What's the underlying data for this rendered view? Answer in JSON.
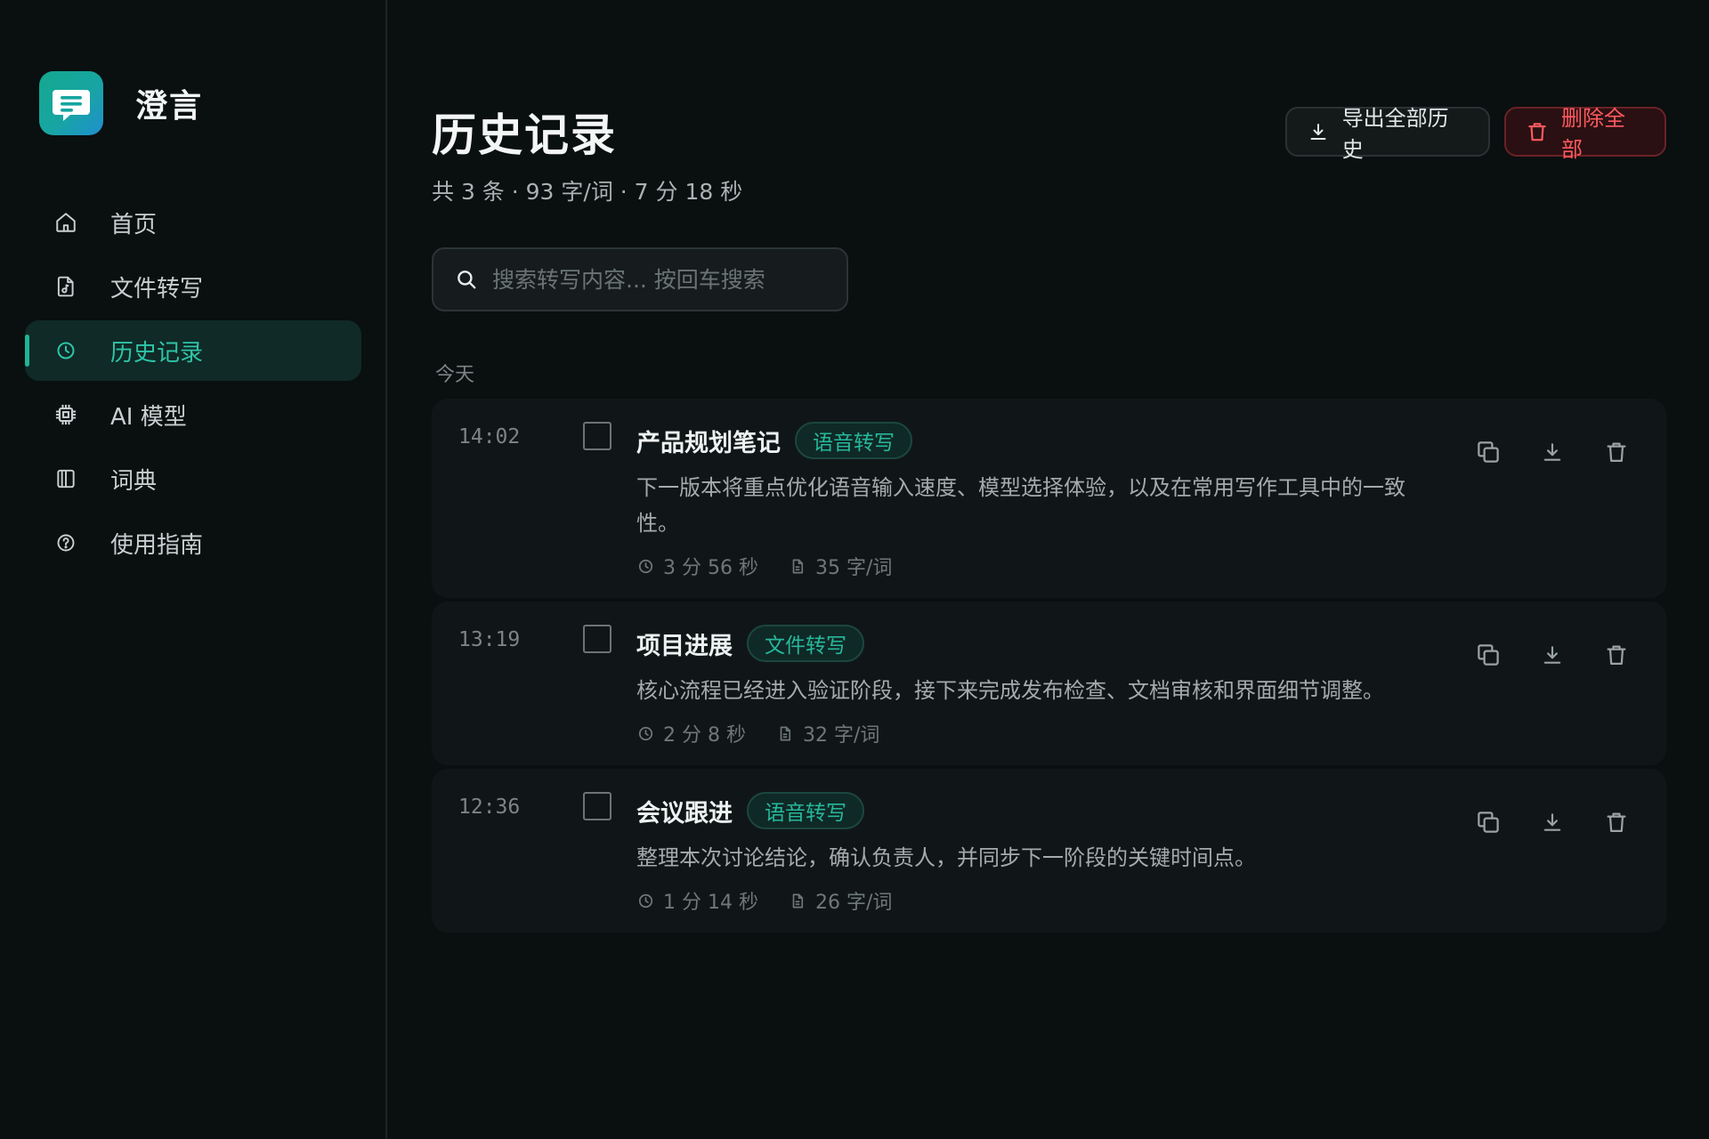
{
  "brand": {
    "name": "澄言"
  },
  "nav": {
    "items": [
      {
        "label": "首页",
        "icon": "home-icon"
      },
      {
        "label": "文件转写",
        "icon": "file-audio-icon"
      },
      {
        "label": "历史记录",
        "icon": "clock-icon",
        "active": true
      },
      {
        "label": "AI 模型",
        "icon": "chip-icon"
      },
      {
        "label": "词典",
        "icon": "book-icon"
      },
      {
        "label": "使用指南",
        "icon": "help-icon"
      }
    ]
  },
  "header": {
    "title": "历史记录",
    "summary": "共 3 条 · 93 字/词 · 7 分 18 秒",
    "export_label": "导出全部历史",
    "delete_all_label": "删除全部"
  },
  "search": {
    "placeholder": "搜索转写内容... 按回车搜索",
    "value": ""
  },
  "group": {
    "label": "今天"
  },
  "records": [
    {
      "time": "14:02",
      "title": "产品规划笔记",
      "badge": "语音转写",
      "text": "下一版本将重点优化语音输入速度、模型选择体验，以及在常用写作工具中的一致性。",
      "duration": "3 分 56 秒",
      "words": "35 字/词"
    },
    {
      "time": "13:19",
      "title": "项目进展",
      "badge": "文件转写",
      "text": "核心流程已经进入验证阶段，接下来完成发布检查、文档审核和界面细节调整。",
      "duration": "2 分 8 秒",
      "words": "32 字/词"
    },
    {
      "time": "12:36",
      "title": "会议跟进",
      "badge": "语音转写",
      "text": "整理本次讨论结论，确认负责人，并同步下一阶段的关键时间点。",
      "duration": "1 分 14 秒",
      "words": "26 字/词"
    }
  ],
  "colors": {
    "accent": "#1fb595",
    "danger": "#ff5a5f",
    "background": "#0a0f10",
    "card": "#101617"
  }
}
